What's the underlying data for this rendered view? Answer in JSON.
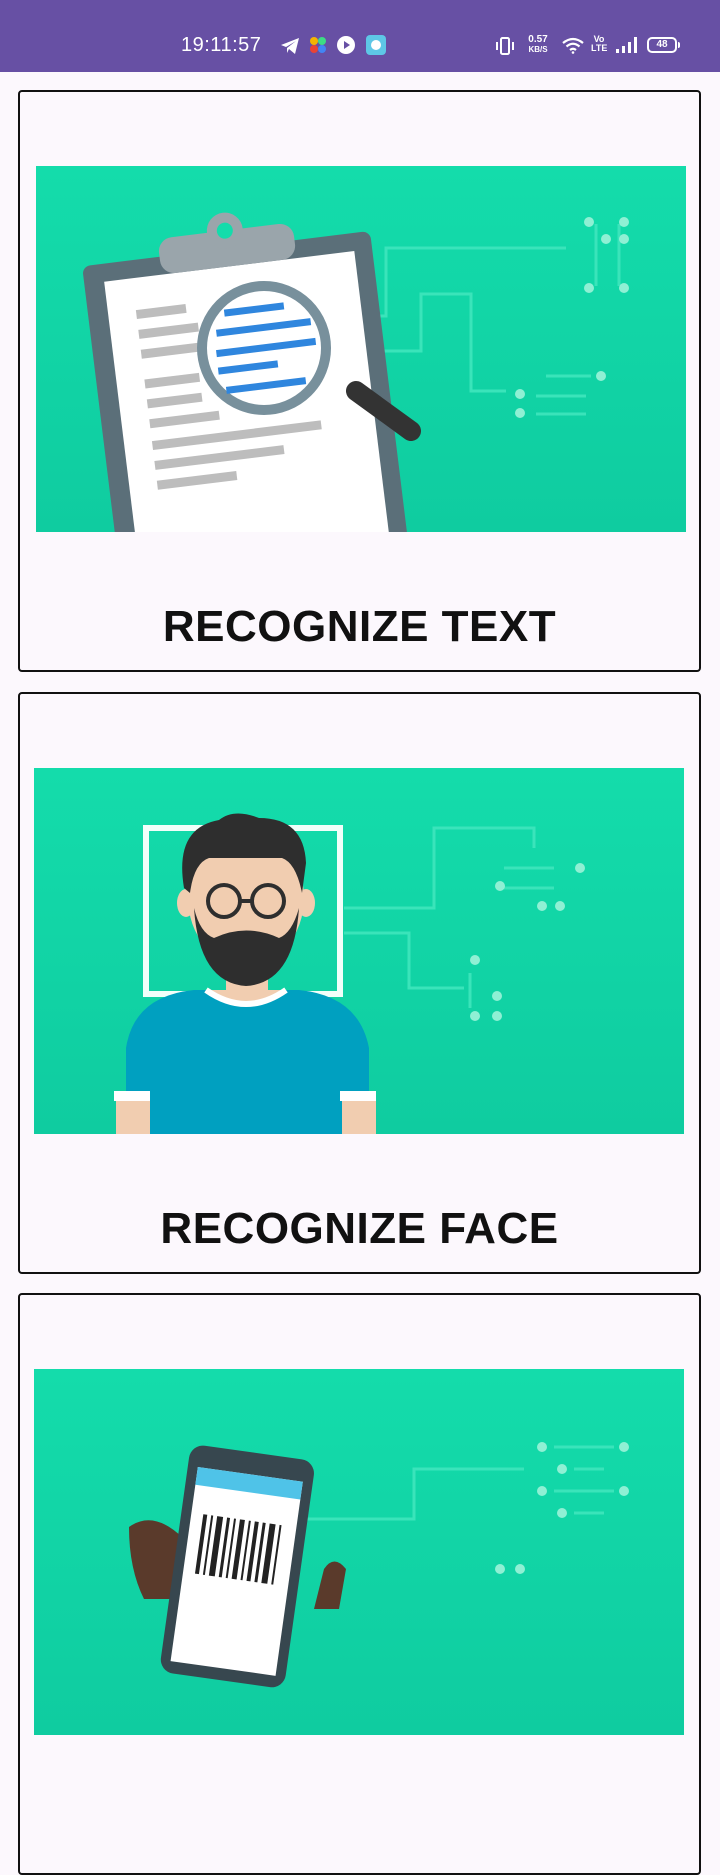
{
  "status_bar": {
    "time": "19:11:57",
    "net_speed_value": "0.57",
    "net_speed_unit": "KB/S",
    "volte_top": "Vo",
    "volte_bottom": "LTE",
    "battery": "48",
    "left_icons": [
      "telegram-icon",
      "pinwheel-app-icon",
      "play-icon",
      "chat-app-icon"
    ],
    "right_icons": [
      "vibrate-icon",
      "wifi-icon",
      "volte-icon",
      "signal-icon",
      "battery-icon"
    ]
  },
  "cards": [
    {
      "label": "RECOGNIZE TEXT"
    },
    {
      "label": "RECOGNIZE FACE"
    },
    {
      "label": ""
    }
  ],
  "colors": {
    "status_bar": "#6750a4",
    "banner_green": "#14dcab",
    "page_background": "#fcf8fd",
    "card_border": "#111111"
  }
}
